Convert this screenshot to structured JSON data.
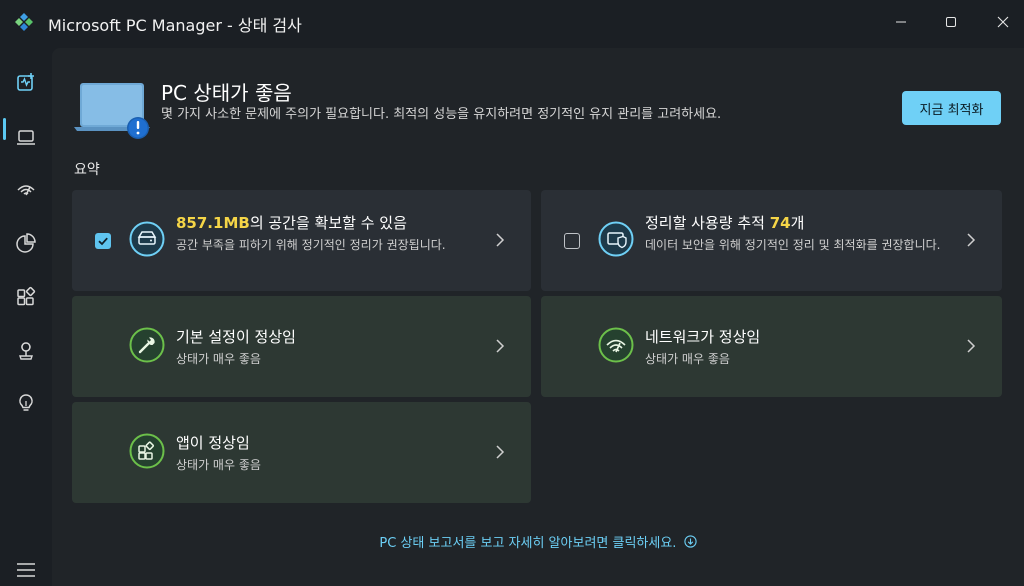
{
  "window": {
    "title": "Microsoft PC Manager - 상태 검사",
    "minimize_icon": "minimize-icon",
    "maximize_icon": "maximize-icon",
    "close_icon": "close-icon"
  },
  "sidebar": {
    "items": [
      {
        "icon": "health-check-icon",
        "active": true
      },
      {
        "icon": "laptop-icon"
      },
      {
        "icon": "network-icon"
      },
      {
        "icon": "pie-chart-icon"
      },
      {
        "icon": "apps-icon"
      },
      {
        "icon": "plant-icon"
      },
      {
        "icon": "lightbulb-icon"
      }
    ],
    "menu_icon": "hamburger-menu-icon"
  },
  "hero": {
    "title": "PC 상태가 좋음",
    "description": "몇 가지 사소한 문제에 주의가 필요합니다. 최적의 성능을 유지하려면 정기적인 유지 관리를 고려하세요.",
    "button": "지금 최적화"
  },
  "summary": {
    "label": "요약",
    "cards": [
      {
        "title_highlight": "857.1MB",
        "title_rest": "의 공간을 확보할 수 있음",
        "subtitle": "공간 부족을 피하기 위해 정기적인 정리가 권장됩니다.",
        "checked": true,
        "icon": "storage-icon"
      },
      {
        "title_prefix": "정리할 사용량 추적 ",
        "title_highlight": "74",
        "title_suffix": "개",
        "subtitle": "데이터 보안을 위해 정기적인 정리 및 최적화를 권장합니다.",
        "checked": false,
        "icon": "privacy-shield-icon"
      },
      {
        "title": "기본 설정이 정상임",
        "subtitle": "상태가 매우 좋음",
        "icon": "wrench-icon"
      },
      {
        "title": "네트워크가 정상임",
        "subtitle": "상태가 매우 좋음",
        "icon": "wifi-icon"
      },
      {
        "title": "앱이 정상임",
        "subtitle": "상태가 매우 좋음",
        "icon": "apps-icon"
      }
    ]
  },
  "footer": {
    "link": "PC 상태 보고서를 보고 자세히 알아보려면 클릭하세요."
  },
  "colors": {
    "accent": "#6fd0f6",
    "highlight": "#f5d547",
    "good": "#6cc04a",
    "background": "#1b1f24"
  }
}
